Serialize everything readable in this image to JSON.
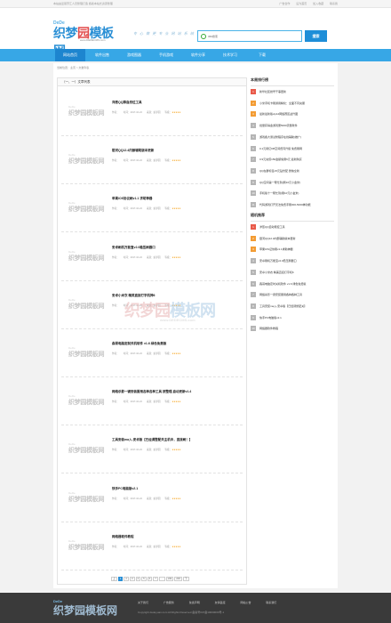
{
  "topbar": {
    "left": "本站由爱丽芳汇人员整理打造 各版本站长资源整理",
    "links": [
      "广告合作",
      "设为首页",
      "加入收藏",
      "联系我"
    ]
  },
  "logo": {
    "dd": "DeDe",
    "zh_a": "织梦",
    "zh_b": "园",
    "zh_c": "模板网",
    "en": "www.DEDECMS.com"
  },
  "slogan": "专 心 做 更 专 业 网 站 系 统",
  "search": {
    "placeholder": "360搜索",
    "button": "搜索"
  },
  "nav": [
    "网站首页",
    "软件出售",
    "游戏图器",
    "手机游戏",
    "软件分享",
    "技术学习",
    "下载"
  ],
  "breadcrumb": "当前位置：主页 > 文章列表",
  "main": {
    "header": "（一、一）文章列表",
    "meta_labels": {
      "author": "作者：",
      "date": "时间：2017-10-24",
      "src": "来源：织梦园",
      "rating": "等级："
    },
    "thumb_text": "织梦园模板网",
    "thumb_sub": "DeDe",
    "articles": [
      {
        "title": "洋葱QQ群自然位工具",
        "stars": "★★★★★"
      },
      {
        "title": "银河QQ12.4内部辅助版本更新",
        "stars": "★★★★★"
      },
      {
        "title": "苹果iOS协议刷v1.1 求助神器",
        "stars": "★★★★★"
      },
      {
        "title": "安卓刷机万能宝v2.0稳压刷器口",
        "stars": "★★★★★"
      },
      {
        "title": "安卓小米衣 精美直接打字机神6",
        "stars": "★★★★★"
      },
      {
        "title": "森哥电脑定制关机软件 v1.6 绿色免费版",
        "stars": "★★★★★"
      },
      {
        "title": "网络杀影一键安装服用各种各种工具 按整理,自动更新v1.4",
        "stars": "★★★★★"
      },
      {
        "title": "工具安装ma入-安卓版【已经调整配关主机中，直接刷！】",
        "stars": "★★★★★"
      },
      {
        "title": "快手PC电脑版v2.1",
        "stars": "★★★★★"
      },
      {
        "title": "网络器软件教程",
        "stars": "★★★★★"
      }
    ]
  },
  "pager": [
    "上",
    "1",
    "2",
    "3",
    "4",
    "5",
    "6",
    "7",
    "…",
    "199",
    "200",
    "下"
  ],
  "side": {
    "rank_title": "本周排行榜",
    "rank": [
      "新华社区抢号干事更新",
      "小米手机卡刷通用精化：全面不同充服",
      "最新最新版vip12网络赛区战升图",
      "批量获得金游戏册5000流量软件",
      "游戏各大测试修程序在线辅助(推广)",
      "0.1元用亿KB空间费同升级 免费刷网",
      "0.9元充值150金额免刷6元 最新购买",
      "QQ在群标签15元钻份配 微信全新",
      "QQ空间第一帮忙到(刷10元小金米)",
      "手机版十一帮忙到(刷10元小金米)",
      "代码游戏打开无法免费手刷300-5000神功能"
    ],
    "rec_title": "随机推荐",
    "rec": [
      "洋葱QQ自动帮控工具",
      "银河QQ12.4内部辅助版本更新",
      "苹果iOS证协刷v1.1求助神器",
      "安卓刷机万能宝v2.0稳压刷器口",
      "安卓小米衣 精美直接打字机6",
      "森哥电脑定时关机软件 v1.6 绿色免费版",
      "网络杀影一键安装服用各种各种工具",
      "工具安装ma入-安卓版【已经调整配关】",
      "快手PC电脑版v2.1",
      "网络器软件教程"
    ]
  },
  "watermark": {
    "zh_a": "织梦园",
    "zh_b": "模板网",
    "en": "www.DEDECMS.com"
  },
  "footer": {
    "links": [
      "关于我们",
      "广告服务",
      "免责声明",
      "友情链接",
      "网站公告",
      "联系我们"
    ],
    "copyright": "Copyright dedeyuan.com All Rights Reserved 备案号ICP备10000000号-1"
  },
  "colors": {
    "brand": "#2a8fd5",
    "nav": "#37a7e6",
    "nav_active": "#1d85cf",
    "star": "#f5a623",
    "rank_hot": "#e95a4a",
    "rank_warm": "#f39c34"
  }
}
